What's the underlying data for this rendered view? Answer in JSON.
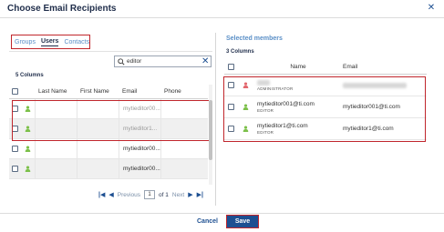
{
  "dialog": {
    "title": "Choose Email Recipients"
  },
  "tabs": [
    {
      "label": "Groups"
    },
    {
      "label": "Users"
    },
    {
      "label": "Contacts"
    }
  ],
  "search": {
    "value": "editor"
  },
  "left": {
    "column_count": "5 Columns",
    "headers": [
      "Last Name",
      "First Name",
      "Email",
      "Phone"
    ],
    "rows": [
      {
        "last": "",
        "first": "",
        "email": "mytieditor00...",
        "phone": ""
      },
      {
        "last": "",
        "first": "",
        "email": "mytieditor1...",
        "phone": ""
      },
      {
        "last": "",
        "first": "",
        "email": "mytieditor00...",
        "phone": ""
      },
      {
        "last": "",
        "first": "",
        "email": "mytieditor00...",
        "phone": ""
      }
    ]
  },
  "pager": {
    "previous": "Previous",
    "page": "1",
    "of": "of 1",
    "next": "Next"
  },
  "right": {
    "title": "Selected members",
    "column_count": "3 Columns",
    "headers": [
      "Name",
      "Email"
    ],
    "rows": [
      {
        "name": "",
        "role": "ADMINISTRATOR",
        "email": ""
      },
      {
        "name": "mytieditor001@ti.com",
        "role": "EDITOR",
        "email": "mytieditor001@ti.com"
      },
      {
        "name": "mytieditor1@ti.com",
        "role": "EDITOR",
        "email": "mytieditor1@ti.com"
      }
    ]
  },
  "footer": {
    "cancel": "Cancel",
    "save": "Save"
  },
  "colors": {
    "accent": "#1d4f91",
    "highlight": "#c0262c",
    "user_green": "#7cc04a",
    "admin_red": "#e2676e"
  }
}
